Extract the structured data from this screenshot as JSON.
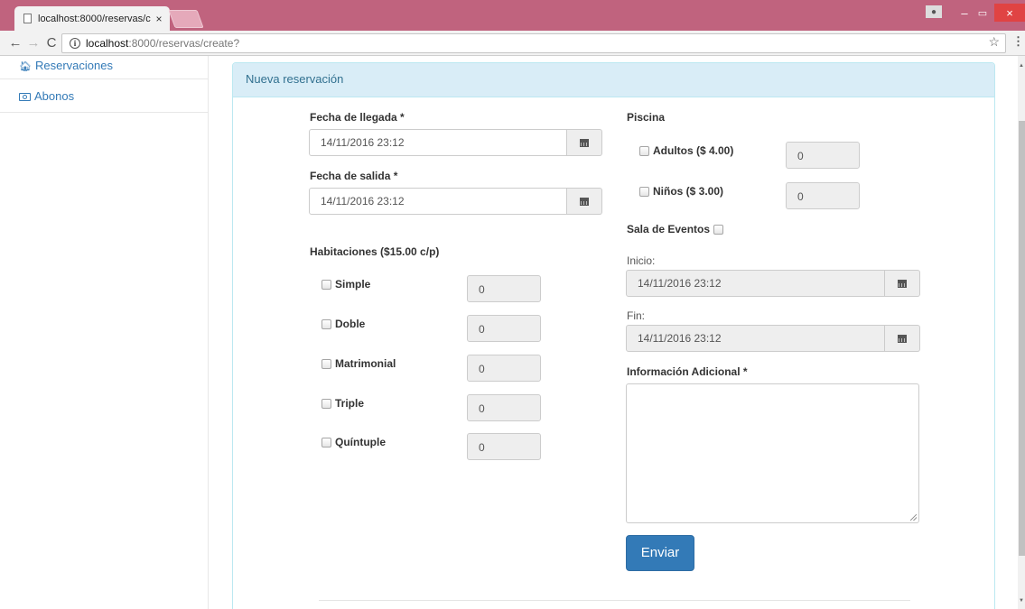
{
  "browser": {
    "tab_title": "localhost:8000/reservas/c",
    "tab_close": "×",
    "url_host": "localhost",
    "url_rest": ":8000/reservas/create?",
    "nav_back": "←",
    "nav_forward": "→",
    "nav_reload": "C",
    "info_glyph": "i",
    "star_glyph": "☆",
    "menu_glyph": "⋮",
    "win_minimize": "–",
    "win_maximize": "▭",
    "win_close": "×"
  },
  "sidebar": {
    "items": [
      {
        "label": "Reservaciones",
        "icon": "home-icon"
      },
      {
        "label": "Abonos",
        "icon": "money-icon"
      }
    ]
  },
  "panel": {
    "heading": "Nueva reservación"
  },
  "form": {
    "arrival_label": "Fecha de llegada *",
    "arrival_value": "14/11/2016 23:12",
    "departure_label": "Fecha de salida *",
    "departure_value": "14/11/2016 23:12",
    "rooms_label": "Habitaciones ($15.00 c/p)",
    "rooms": [
      {
        "label": "Simple",
        "value": "0"
      },
      {
        "label": "Doble",
        "value": "0"
      },
      {
        "label": "Matrimonial",
        "value": "0"
      },
      {
        "label": "Triple",
        "value": "0"
      },
      {
        "label": "Quíntuple",
        "value": "0"
      }
    ],
    "pool_label": "Piscina",
    "pool": [
      {
        "label": "Adultos ($ 4.00)",
        "value": "0"
      },
      {
        "label": "Niños ($ 3.00)",
        "value": "0"
      }
    ],
    "event_hall_label": "Sala de Eventos",
    "start_label": "Inicio:",
    "start_value": "14/11/2016 23:12",
    "end_label": "Fin:",
    "end_value": "14/11/2016 23:12",
    "additional_info_label": "Información Adicional *",
    "additional_info_value": "",
    "submit_label": "Enviar"
  }
}
